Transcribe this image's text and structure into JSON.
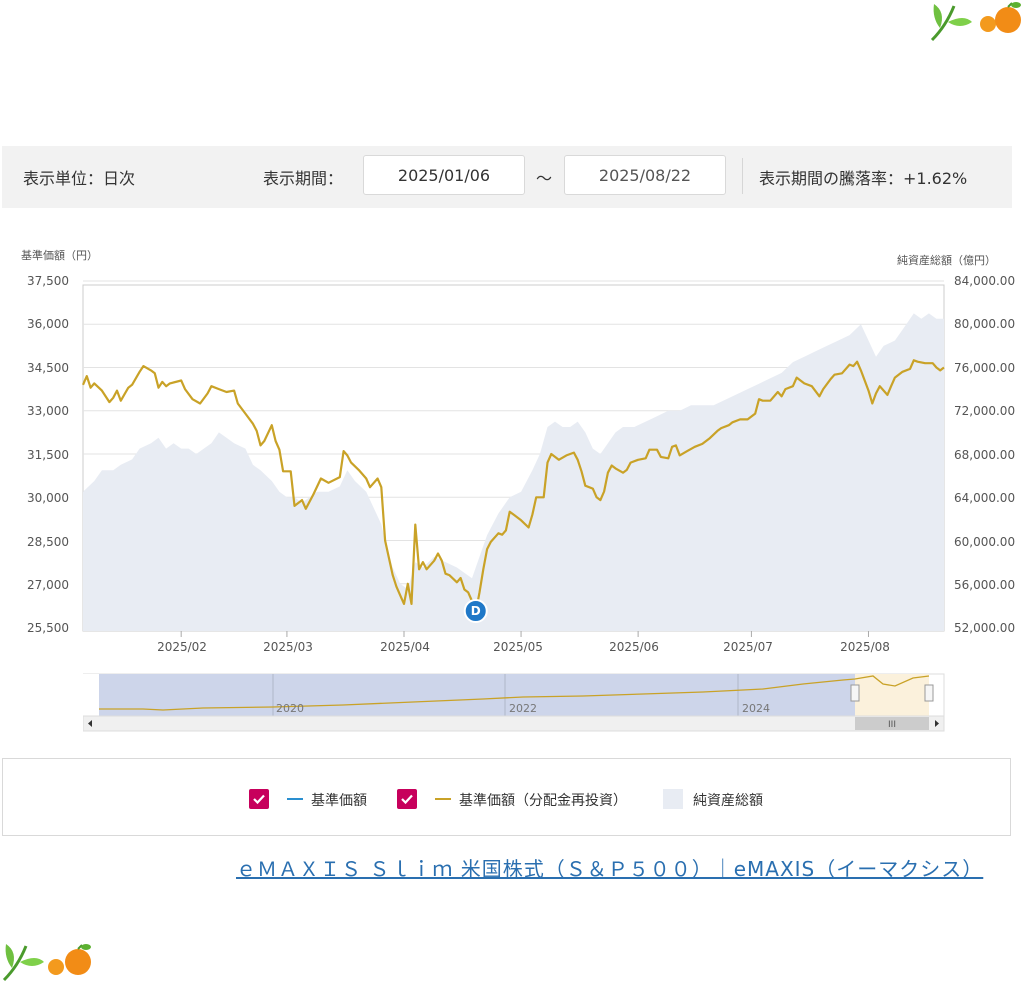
{
  "controls": {
    "unit_label": "表示単位：日次",
    "period_label": "表示期間：",
    "start_date": "2025/01/06",
    "tilde": "～",
    "end_date": "2025/08/22",
    "change_label": "表示期間の騰落率：+1.62%"
  },
  "chart_data": {
    "type": "line",
    "left_axis_title": "基準価額（円）",
    "right_axis_title": "純資産総額（億円）",
    "left_ticks": [
      "37,500",
      "36,000",
      "34,500",
      "33,000",
      "31,500",
      "30,000",
      "28,500",
      "27,000",
      "25,500"
    ],
    "right_ticks": [
      "84,000.00",
      "80,000.00",
      "76,000.00",
      "72,000.00",
      "68,000.00",
      "64,000.00",
      "60,000.00",
      "56,000.00",
      "52,000.00"
    ],
    "ylim_left": [
      25500,
      37500
    ],
    "ylim_right": [
      52000,
      84000
    ],
    "x_ticks": [
      "2025/02",
      "2025/03",
      "2025/04",
      "2025/05",
      "2025/06",
      "2025/07",
      "2025/08"
    ],
    "x_tick_days": [
      26,
      54,
      85,
      116,
      147,
      177,
      208
    ],
    "xlim_days": [
      0,
      228
    ],
    "series": [
      {
        "name": "基準価額（分配金再投資）",
        "color": "#c9a227",
        "points": [
          [
            0,
            33900
          ],
          [
            1,
            34200
          ],
          [
            2,
            33800
          ],
          [
            3,
            33950
          ],
          [
            5,
            33700
          ],
          [
            7,
            33300
          ],
          [
            8,
            33450
          ],
          [
            9,
            33700
          ],
          [
            10,
            33350
          ],
          [
            12,
            33800
          ],
          [
            13,
            33900
          ],
          [
            15,
            34350
          ],
          [
            16,
            34550
          ],
          [
            18,
            34400
          ],
          [
            19,
            34300
          ],
          [
            20,
            33800
          ],
          [
            21,
            34000
          ],
          [
            22,
            33850
          ],
          [
            23,
            33950
          ],
          [
            26,
            34050
          ],
          [
            27,
            33750
          ],
          [
            29,
            33400
          ],
          [
            31,
            33250
          ],
          [
            33,
            33600
          ],
          [
            34,
            33850
          ],
          [
            36,
            33750
          ],
          [
            38,
            33650
          ],
          [
            40,
            33700
          ],
          [
            41,
            33250
          ],
          [
            43,
            32900
          ],
          [
            45,
            32550
          ],
          [
            46,
            32300
          ],
          [
            47,
            31800
          ],
          [
            48,
            31950
          ],
          [
            50,
            32500
          ],
          [
            51,
            31950
          ],
          [
            52,
            31650
          ],
          [
            53,
            30900
          ],
          [
            55,
            30900
          ],
          [
            56,
            29700
          ],
          [
            58,
            29900
          ],
          [
            59,
            29600
          ],
          [
            61,
            30100
          ],
          [
            63,
            30650
          ],
          [
            65,
            30500
          ],
          [
            68,
            30700
          ],
          [
            69,
            31600
          ],
          [
            70,
            31450
          ],
          [
            71,
            31200
          ],
          [
            73,
            30950
          ],
          [
            75,
            30650
          ],
          [
            76,
            30350
          ],
          [
            78,
            30650
          ],
          [
            79,
            30350
          ],
          [
            80,
            28500
          ],
          [
            82,
            27300
          ],
          [
            83,
            26900
          ],
          [
            84,
            26600
          ],
          [
            85,
            26300
          ],
          [
            86,
            27000
          ],
          [
            87,
            26300
          ],
          [
            88,
            29050
          ],
          [
            89,
            27500
          ],
          [
            90,
            27750
          ],
          [
            91,
            27500
          ],
          [
            93,
            27800
          ],
          [
            94,
            28050
          ],
          [
            95,
            27800
          ],
          [
            96,
            27350
          ],
          [
            97,
            27300
          ],
          [
            99,
            27050
          ],
          [
            100,
            27200
          ],
          [
            101,
            26800
          ],
          [
            102,
            26700
          ],
          [
            103,
            26400
          ],
          [
            104,
            26000
          ],
          [
            105,
            26700
          ],
          [
            106,
            27500
          ],
          [
            107,
            28200
          ],
          [
            108,
            28450
          ],
          [
            110,
            28750
          ],
          [
            111,
            28700
          ],
          [
            112,
            28850
          ],
          [
            113,
            29500
          ],
          [
            114,
            29400
          ],
          [
            116,
            29200
          ],
          [
            118,
            28950
          ],
          [
            119,
            29400
          ],
          [
            120,
            30000
          ],
          [
            122,
            30000
          ],
          [
            123,
            31200
          ],
          [
            124,
            31500
          ],
          [
            126,
            31300
          ],
          [
            128,
            31450
          ],
          [
            130,
            31550
          ],
          [
            131,
            31300
          ],
          [
            132,
            30900
          ],
          [
            133,
            30400
          ],
          [
            135,
            30300
          ],
          [
            136,
            30000
          ],
          [
            137,
            29900
          ],
          [
            138,
            30200
          ],
          [
            139,
            30850
          ],
          [
            140,
            31100
          ],
          [
            141,
            31000
          ],
          [
            143,
            30850
          ],
          [
            144,
            30950
          ],
          [
            145,
            31200
          ],
          [
            147,
            31300
          ],
          [
            149,
            31350
          ],
          [
            150,
            31650
          ],
          [
            152,
            31650
          ],
          [
            153,
            31400
          ],
          [
            155,
            31350
          ],
          [
            156,
            31750
          ],
          [
            157,
            31800
          ],
          [
            158,
            31450
          ],
          [
            160,
            31600
          ],
          [
            162,
            31750
          ],
          [
            164,
            31850
          ],
          [
            166,
            32050
          ],
          [
            168,
            32300
          ],
          [
            169,
            32400
          ],
          [
            171,
            32500
          ],
          [
            172,
            32600
          ],
          [
            174,
            32700
          ],
          [
            176,
            32700
          ],
          [
            178,
            32900
          ],
          [
            179,
            33400
          ],
          [
            180,
            33350
          ],
          [
            182,
            33350
          ],
          [
            184,
            33650
          ],
          [
            185,
            33500
          ],
          [
            186,
            33750
          ],
          [
            188,
            33850
          ],
          [
            189,
            34150
          ],
          [
            191,
            33950
          ],
          [
            193,
            33850
          ],
          [
            195,
            33500
          ],
          [
            196,
            33750
          ],
          [
            198,
            34100
          ],
          [
            199,
            34250
          ],
          [
            201,
            34300
          ],
          [
            203,
            34600
          ],
          [
            204,
            34550
          ],
          [
            205,
            34700
          ],
          [
            206,
            34400
          ],
          [
            208,
            33700
          ],
          [
            209,
            33250
          ],
          [
            210,
            33600
          ],
          [
            211,
            33850
          ],
          [
            213,
            33550
          ],
          [
            214,
            33850
          ],
          [
            215,
            34150
          ],
          [
            217,
            34350
          ],
          [
            219,
            34450
          ],
          [
            220,
            34750
          ],
          [
            221,
            34700
          ],
          [
            223,
            34650
          ],
          [
            225,
            34650
          ],
          [
            226,
            34500
          ],
          [
            227,
            34400
          ],
          [
            228,
            34500
          ]
        ]
      },
      {
        "name": "純資産総額",
        "color": "#e8ecf3",
        "points": [
          [
            0,
            64500
          ],
          [
            3,
            65500
          ],
          [
            5,
            66500
          ],
          [
            8,
            66500
          ],
          [
            10,
            67000
          ],
          [
            13,
            67500
          ],
          [
            15,
            68500
          ],
          [
            18,
            69000
          ],
          [
            20,
            69500
          ],
          [
            22,
            68500
          ],
          [
            24,
            69000
          ],
          [
            26,
            68500
          ],
          [
            28,
            68500
          ],
          [
            30,
            68000
          ],
          [
            32,
            68500
          ],
          [
            34,
            69000
          ],
          [
            36,
            70000
          ],
          [
            38,
            69500
          ],
          [
            40,
            69000
          ],
          [
            43,
            68500
          ],
          [
            45,
            67000
          ],
          [
            47,
            66500
          ],
          [
            50,
            65500
          ],
          [
            52,
            64500
          ],
          [
            54,
            64000
          ],
          [
            56,
            64000
          ],
          [
            58,
            63500
          ],
          [
            60,
            64000
          ],
          [
            62,
            64500
          ],
          [
            65,
            64500
          ],
          [
            68,
            65000
          ],
          [
            70,
            66500
          ],
          [
            72,
            65500
          ],
          [
            75,
            64500
          ],
          [
            77,
            63000
          ],
          [
            79,
            61500
          ],
          [
            80,
            60000
          ],
          [
            82,
            57500
          ],
          [
            84,
            56000
          ],
          [
            86,
            55500
          ],
          [
            88,
            58000
          ],
          [
            90,
            57500
          ],
          [
            93,
            58500
          ],
          [
            96,
            58000
          ],
          [
            99,
            57500
          ],
          [
            101,
            57000
          ],
          [
            103,
            56500
          ],
          [
            105,
            58500
          ],
          [
            107,
            60500
          ],
          [
            110,
            62500
          ],
          [
            113,
            64000
          ],
          [
            116,
            64500
          ],
          [
            119,
            66500
          ],
          [
            121,
            68000
          ],
          [
            123,
            70500
          ],
          [
            125,
            71000
          ],
          [
            127,
            70500
          ],
          [
            129,
            70500
          ],
          [
            131,
            71000
          ],
          [
            133,
            70000
          ],
          [
            135,
            68500
          ],
          [
            137,
            68000
          ],
          [
            139,
            69000
          ],
          [
            141,
            70000
          ],
          [
            143,
            70500
          ],
          [
            146,
            70500
          ],
          [
            149,
            71000
          ],
          [
            152,
            71500
          ],
          [
            155,
            72000
          ],
          [
            158,
            72000
          ],
          [
            161,
            72500
          ],
          [
            164,
            72500
          ],
          [
            167,
            72500
          ],
          [
            170,
            73000
          ],
          [
            173,
            73500
          ],
          [
            176,
            74000
          ],
          [
            179,
            74500
          ],
          [
            182,
            75000
          ],
          [
            185,
            75500
          ],
          [
            188,
            76500
          ],
          [
            191,
            77000
          ],
          [
            194,
            77500
          ],
          [
            197,
            78000
          ],
          [
            200,
            78500
          ],
          [
            203,
            79000
          ],
          [
            206,
            80000
          ],
          [
            208,
            78500
          ],
          [
            210,
            77000
          ],
          [
            212,
            78000
          ],
          [
            215,
            78500
          ],
          [
            217,
            79500
          ],
          [
            220,
            81000
          ],
          [
            222,
            80500
          ],
          [
            224,
            81000
          ],
          [
            226,
            80500
          ],
          [
            228,
            80500
          ]
        ]
      }
    ],
    "dividend_marker": {
      "label": "D",
      "day": 104
    },
    "navigator": {
      "year_labels": [
        "2020",
        "2022",
        "2024"
      ],
      "scroll_label": "III"
    }
  },
  "legend": {
    "item1": "基準価額",
    "item1_color": "#2a8fd0",
    "item2": "基準価額（分配金再投資）",
    "item2_color": "#c9a227",
    "item3": "純資産総額"
  },
  "link_text": "ｅＭＡＸＩＳ Ｓｌｉｍ 米国株式（Ｓ＆Ｐ５００）｜eMAXIS（イーマクシス）"
}
